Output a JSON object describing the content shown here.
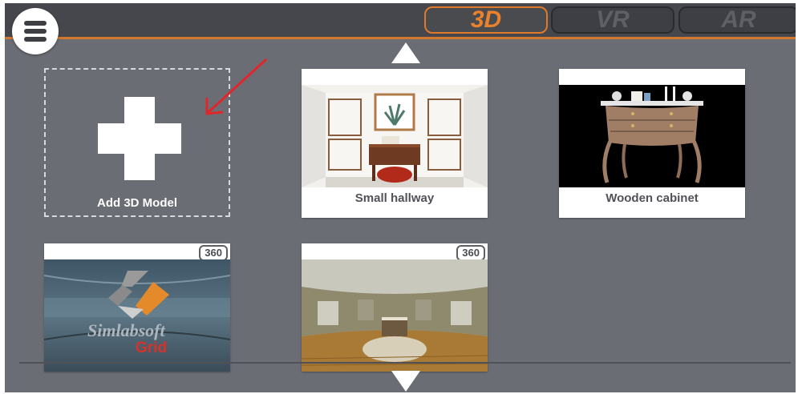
{
  "menu": {
    "icon": "hamburger-menu-icon"
  },
  "modes": [
    {
      "label": "3D",
      "active": true
    },
    {
      "label": "VR",
      "active": false
    },
    {
      "label": "AR",
      "active": false
    }
  ],
  "add_tile": {
    "label": "Add 3D Model",
    "icon": "plus-icon"
  },
  "models": [
    {
      "label": "Small hallway",
      "badge": ""
    },
    {
      "label": "Wooden cabinet",
      "badge": ""
    },
    {
      "label": "",
      "badge": "360",
      "watermark_top": "Simlabsoft",
      "watermark_bottom": "Grid"
    },
    {
      "label": "",
      "badge": "360"
    }
  ],
  "colors": {
    "accent": "#e9822f",
    "panel": "#6b6d74",
    "topbar": "#45474c",
    "annotation_arrow": "#e0262a"
  }
}
